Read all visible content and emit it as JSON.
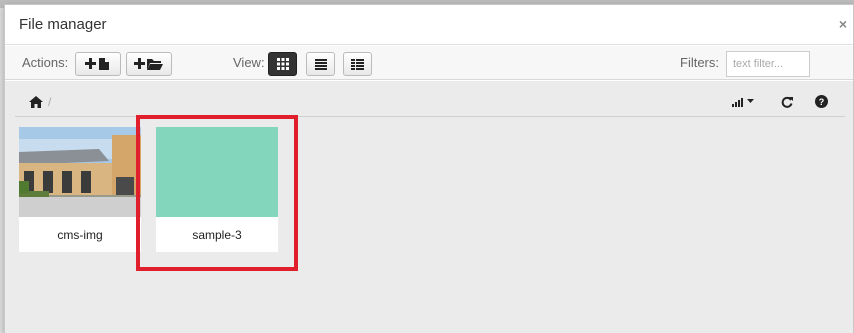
{
  "dialog": {
    "title": "File manager",
    "close_label": "×"
  },
  "toolbar": {
    "actions_label": "Actions:",
    "view_label": "View:",
    "filters_label": "Filters:",
    "filter_placeholder": "text filter...",
    "active_view": "grid"
  },
  "breadcrumb": {
    "separator": "/"
  },
  "files": [
    {
      "name": "cms-img",
      "type": "image"
    },
    {
      "name": "sample-3",
      "type": "image",
      "color": "#83d6bc"
    }
  ],
  "colors": {
    "highlight": "#e01e2c",
    "sample_tile": "#83d6bc"
  }
}
